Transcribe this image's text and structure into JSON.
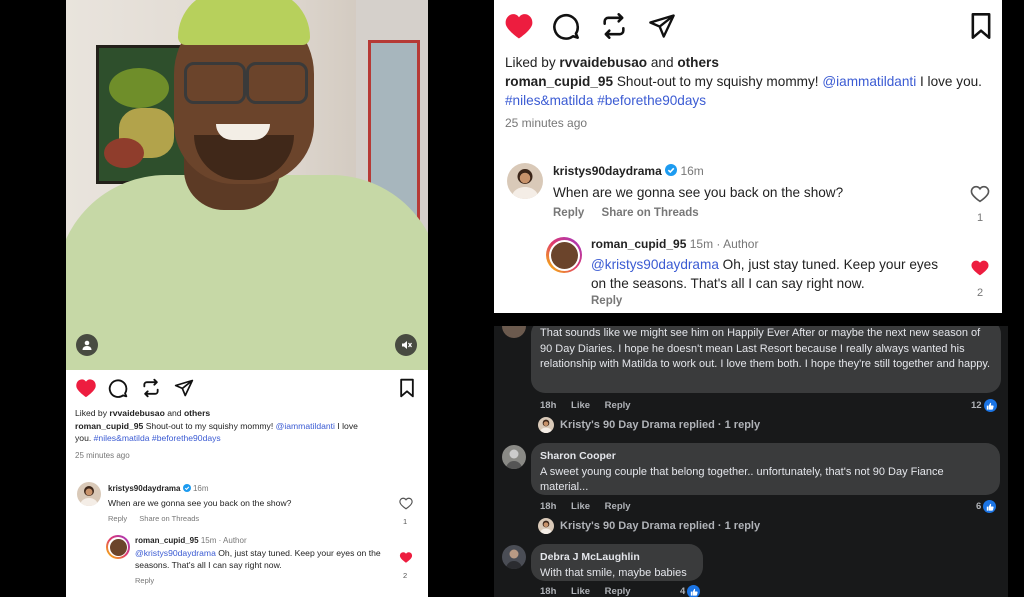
{
  "post": {
    "liked_by_prefix": "Liked by",
    "liked_by_user": "rvvaidebusao",
    "liked_by_and": "and",
    "liked_by_others": "others",
    "caption_user": "roman_cupid_95",
    "caption_text": "Shout-out to my squishy mommy!",
    "caption_mention": "@iammatildanti",
    "caption_tail": "I love you.",
    "hashtag1": "#niles&matilda",
    "hashtag2": "#beforethe90days",
    "time": "25 minutes ago"
  },
  "comment": {
    "user": "kristys90daydrama",
    "time": "16m",
    "text": "When are we gonna see you back on the show?",
    "reply_label": "Reply",
    "share_label": "Share on Threads",
    "like_count": "1"
  },
  "reply": {
    "user": "roman_cupid_95",
    "time": "15m",
    "badge": "Author",
    "mention": "@kristys90daydrama",
    "text": "Oh, just stay tuned. Keep your eyes on the seasons. That's all I can say right now.",
    "reply_label": "Reply",
    "like_count": "2"
  },
  "facebook": {
    "comment1": {
      "text": "That sounds like we might see him on Happily Ever After or maybe the next new season of 90 Day Diaries. I hope he doesn't mean Last Resort because I really always wanted his relationship with Matilda to work out. I love them both. I hope they're still together and happy.",
      "time": "18h",
      "like_label": "Like",
      "reply_label": "Reply",
      "reactions": "12"
    },
    "replied1": "Kristy's 90 Day Drama replied · 1 reply",
    "comment2": {
      "name": "Sharon Cooper",
      "text": "A sweet young couple that belong together.. unfortunately, that's not 90 Day Fiance material...",
      "time": "18h",
      "like_label": "Like",
      "reply_label": "Reply",
      "reactions": "6"
    },
    "replied2": "Kristy's 90 Day Drama replied · 1 reply",
    "comment3": {
      "name": "Debra J McLaughlin",
      "text": "With that smile, maybe babies",
      "time": "18h",
      "like_label": "Like",
      "reply_label": "Reply",
      "reactions": "4"
    }
  },
  "colors": {
    "heart": "#ed1d3f",
    "link": "#3b5bd3",
    "fb_bg": "#18191a",
    "fb_bubble": "#3a3b3c",
    "fb_like": "#1b74e4"
  },
  "icons": [
    "heart-icon",
    "comment-icon",
    "repost-icon",
    "share-icon",
    "bookmark-icon",
    "user-tag-icon",
    "mute-icon",
    "verified-icon",
    "like-icon"
  ]
}
